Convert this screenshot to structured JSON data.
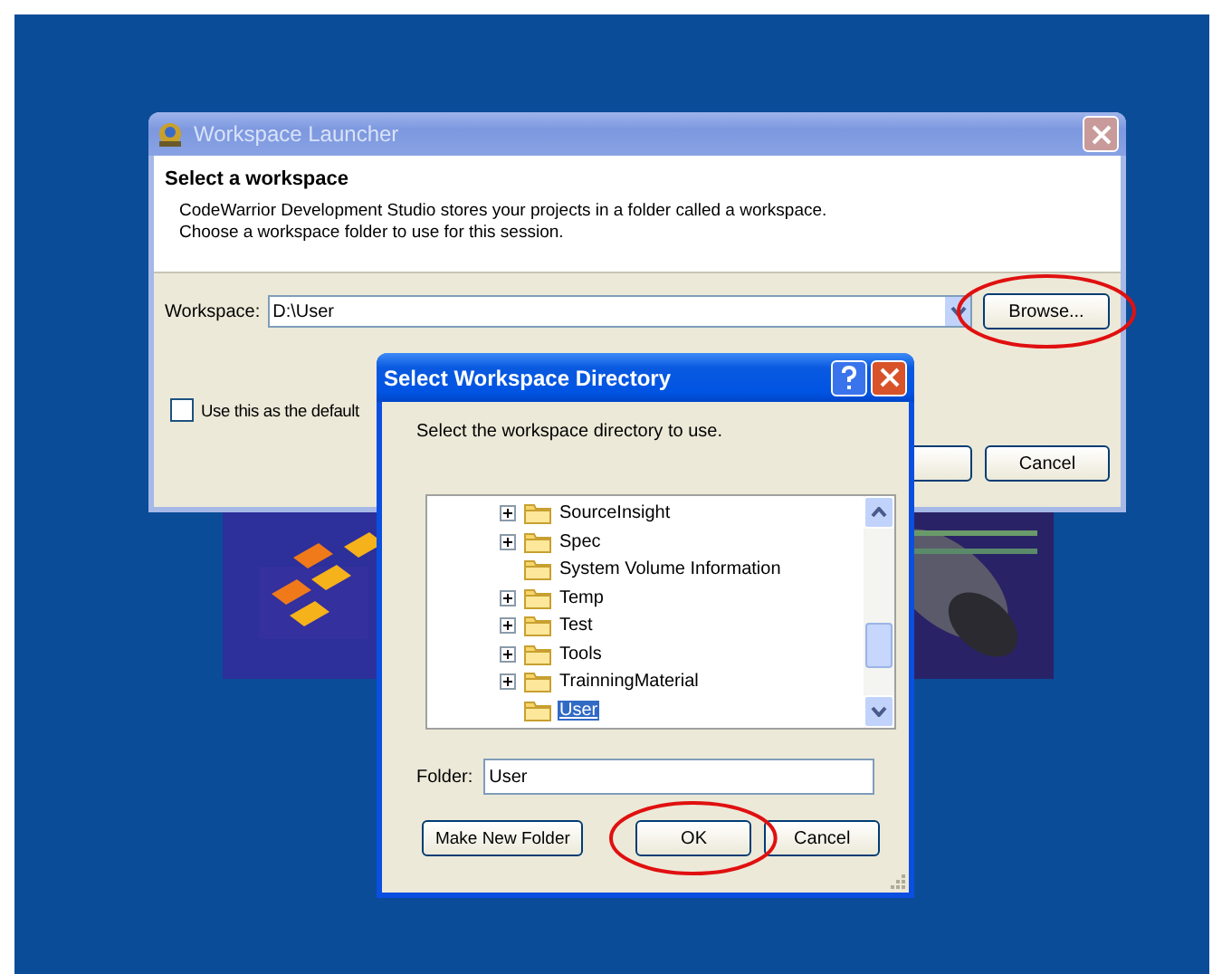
{
  "launcher": {
    "title": "Workspace Launcher",
    "active": false,
    "heading": "Select a workspace",
    "description": [
      "CodeWarrior Development Studio stores your projects in a folder called a workspace.",
      "Choose a workspace folder to use for this session."
    ],
    "workspace": {
      "label": "Workspace:",
      "value": "D:\\User"
    },
    "browse": {
      "label": "Browse...",
      "highlighted": true
    },
    "default_checkbox": {
      "label": "Use this as the default",
      "checked": false
    },
    "cancel": {
      "label": "Cancel",
      "highlighted": false
    }
  },
  "dialog": {
    "title": "Select Workspace Directory",
    "active": true,
    "prompt": "Select the workspace directory to use.",
    "tree": [
      {
        "label": "SourceInsight",
        "expandable": true,
        "selected": false
      },
      {
        "label": "Spec",
        "expandable": true,
        "selected": false
      },
      {
        "label": "System Volume Information",
        "expandable": false,
        "selected": false
      },
      {
        "label": "Temp",
        "expandable": true,
        "selected": false
      },
      {
        "label": "Test",
        "expandable": true,
        "selected": false
      },
      {
        "label": "Tools",
        "expandable": true,
        "selected": false
      },
      {
        "label": "TrainningMaterial",
        "expandable": true,
        "selected": false
      },
      {
        "label": "User",
        "expandable": false,
        "selected": true
      }
    ],
    "folder": {
      "label": "Folder:",
      "value": "User"
    },
    "buttons": [
      {
        "label": "Make New Folder",
        "highlighted": false
      },
      {
        "label": "OK",
        "highlighted": true
      },
      {
        "label": "Cancel",
        "highlighted": false
      }
    ]
  }
}
